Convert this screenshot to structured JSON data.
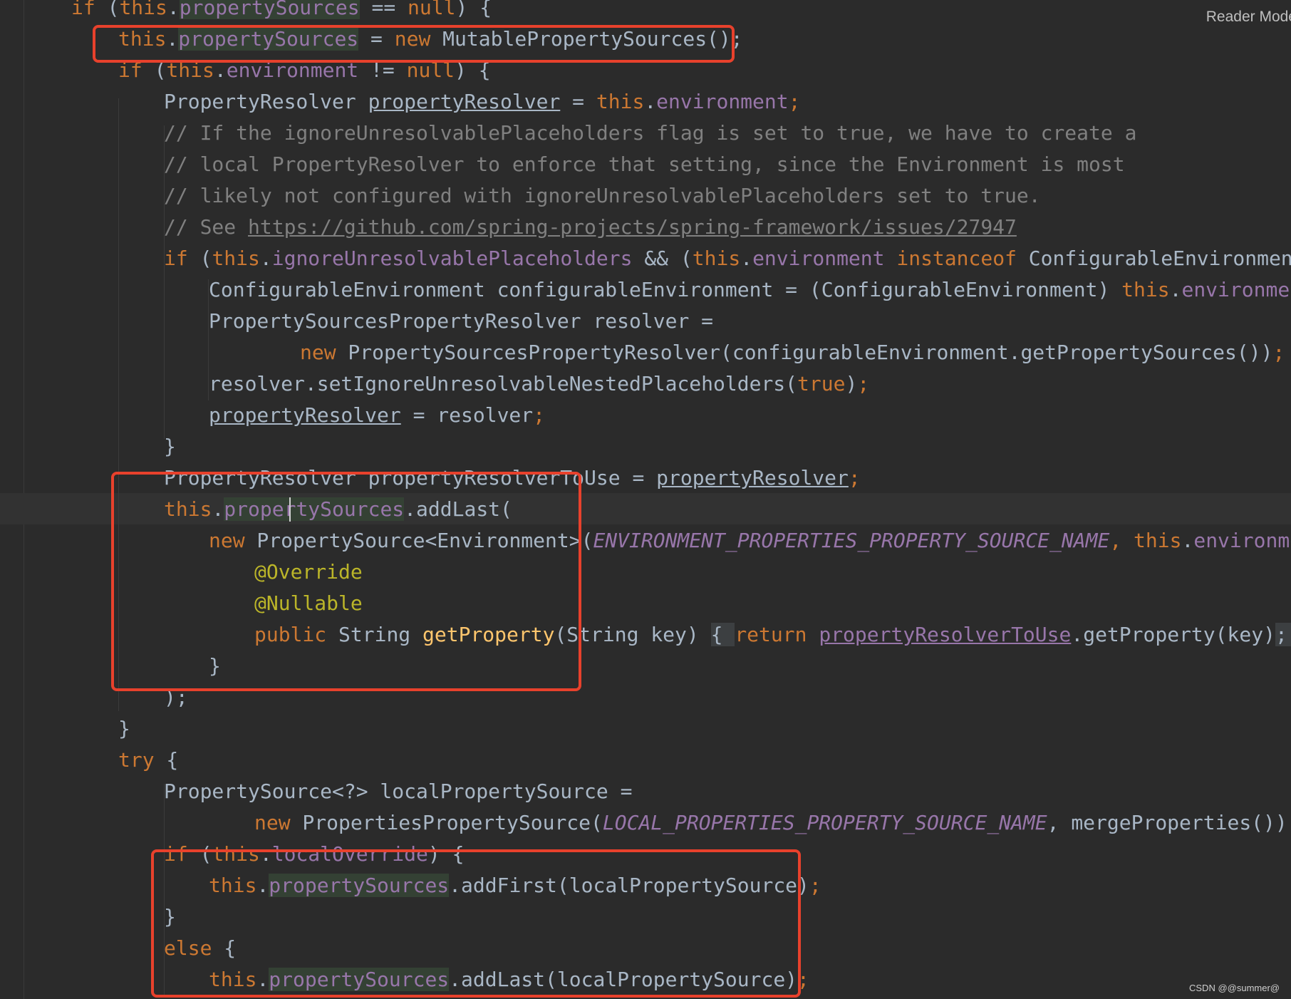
{
  "editor": {
    "reader_mode_label": "Reader Mode",
    "watermark": "CSDN @@summer@"
  },
  "code": {
    "l1": [
      "if",
      " (",
      "this",
      ".",
      "propertySources",
      " == ",
      "null",
      ") {"
    ],
    "l2": [
      "this",
      ".",
      "propertySources",
      " = ",
      "new",
      " MutablePropertySources();"
    ],
    "l3": [
      "if",
      " (",
      "this",
      ".",
      "environment",
      " != ",
      "null",
      ") {"
    ],
    "l4": [
      "PropertyResolver ",
      "propertyResolver",
      " = ",
      "this",
      ".",
      "environment",
      ";"
    ],
    "l5": "// If the ignoreUnresolvablePlaceholders flag is set to true, we have to create a",
    "l6": "// local PropertyResolver to enforce that setting, since the Environment is most",
    "l7": "// likely not configured with ignoreUnresolvablePlaceholders set to true.",
    "l8": [
      "// See ",
      "https://github.com/spring-projects/spring-framework/issues/27947"
    ],
    "l9": [
      "if",
      " (",
      "this",
      ".",
      "ignoreUnresolvablePlaceholders",
      " && (",
      "this",
      ".",
      "environment",
      " ",
      "instanceof",
      " ConfigurableEnvironment)) {"
    ],
    "l10": [
      "ConfigurableEnvironment configurableEnvironment = (ConfigurableEnvironment) ",
      "this",
      ".",
      "environment",
      ";"
    ],
    "l11": "PropertySourcesPropertyResolver resolver =",
    "l12": [
      "new",
      " PropertySourcesPropertyResolver(configurableEnvironment.getPropertySources())",
      ";"
    ],
    "l13": [
      "resolver.setIgnoreUnresolvableNestedPlaceholders(",
      "true",
      ")",
      ";"
    ],
    "l14": [
      "propertyResolver",
      " = resolver",
      ";"
    ],
    "l15": "}",
    "l16": [
      "PropertyResolver propertyResolverToUse = ",
      "propertyResolver",
      ";"
    ],
    "l17": [
      "this",
      ".",
      "propertySources",
      ".addLast("
    ],
    "l18": [
      "new",
      " PropertySource<Environment>(",
      "ENVIRONMENT_PROPERTIES_PROPERTY_SOURCE_NAME",
      ", ",
      "this",
      ".",
      "environment",
      ")"
    ],
    "l19": "@Override",
    "l20": "@Nullable",
    "l21": [
      "public",
      " String ",
      "getProperty",
      "(String key) ",
      "{ ",
      "return",
      " ",
      "propertyResolverToUse",
      ".getProperty(key)",
      "; }"
    ],
    "l22": "}",
    "l23": ");",
    "l24": "}",
    "l25": [
      "try",
      " {"
    ],
    "l26": "PropertySource<?> localPropertySource =",
    "l27": [
      "new",
      " PropertiesPropertySource(",
      "LOCAL_PROPERTIES_PROPERTY_SOURCE_NAME",
      ", mergeProperties())",
      ";"
    ],
    "l28": [
      "if",
      " (",
      "this",
      ".",
      "localOverride",
      ") {"
    ],
    "l29": [
      "this",
      ".",
      "propertySources",
      ".addFirst(localPropertySource)",
      ";"
    ],
    "l30": "}",
    "l31": [
      "else",
      " {"
    ],
    "l32": [
      "this",
      ".",
      "propertySources",
      ".addLast(localPropertySource)",
      ";"
    ]
  }
}
